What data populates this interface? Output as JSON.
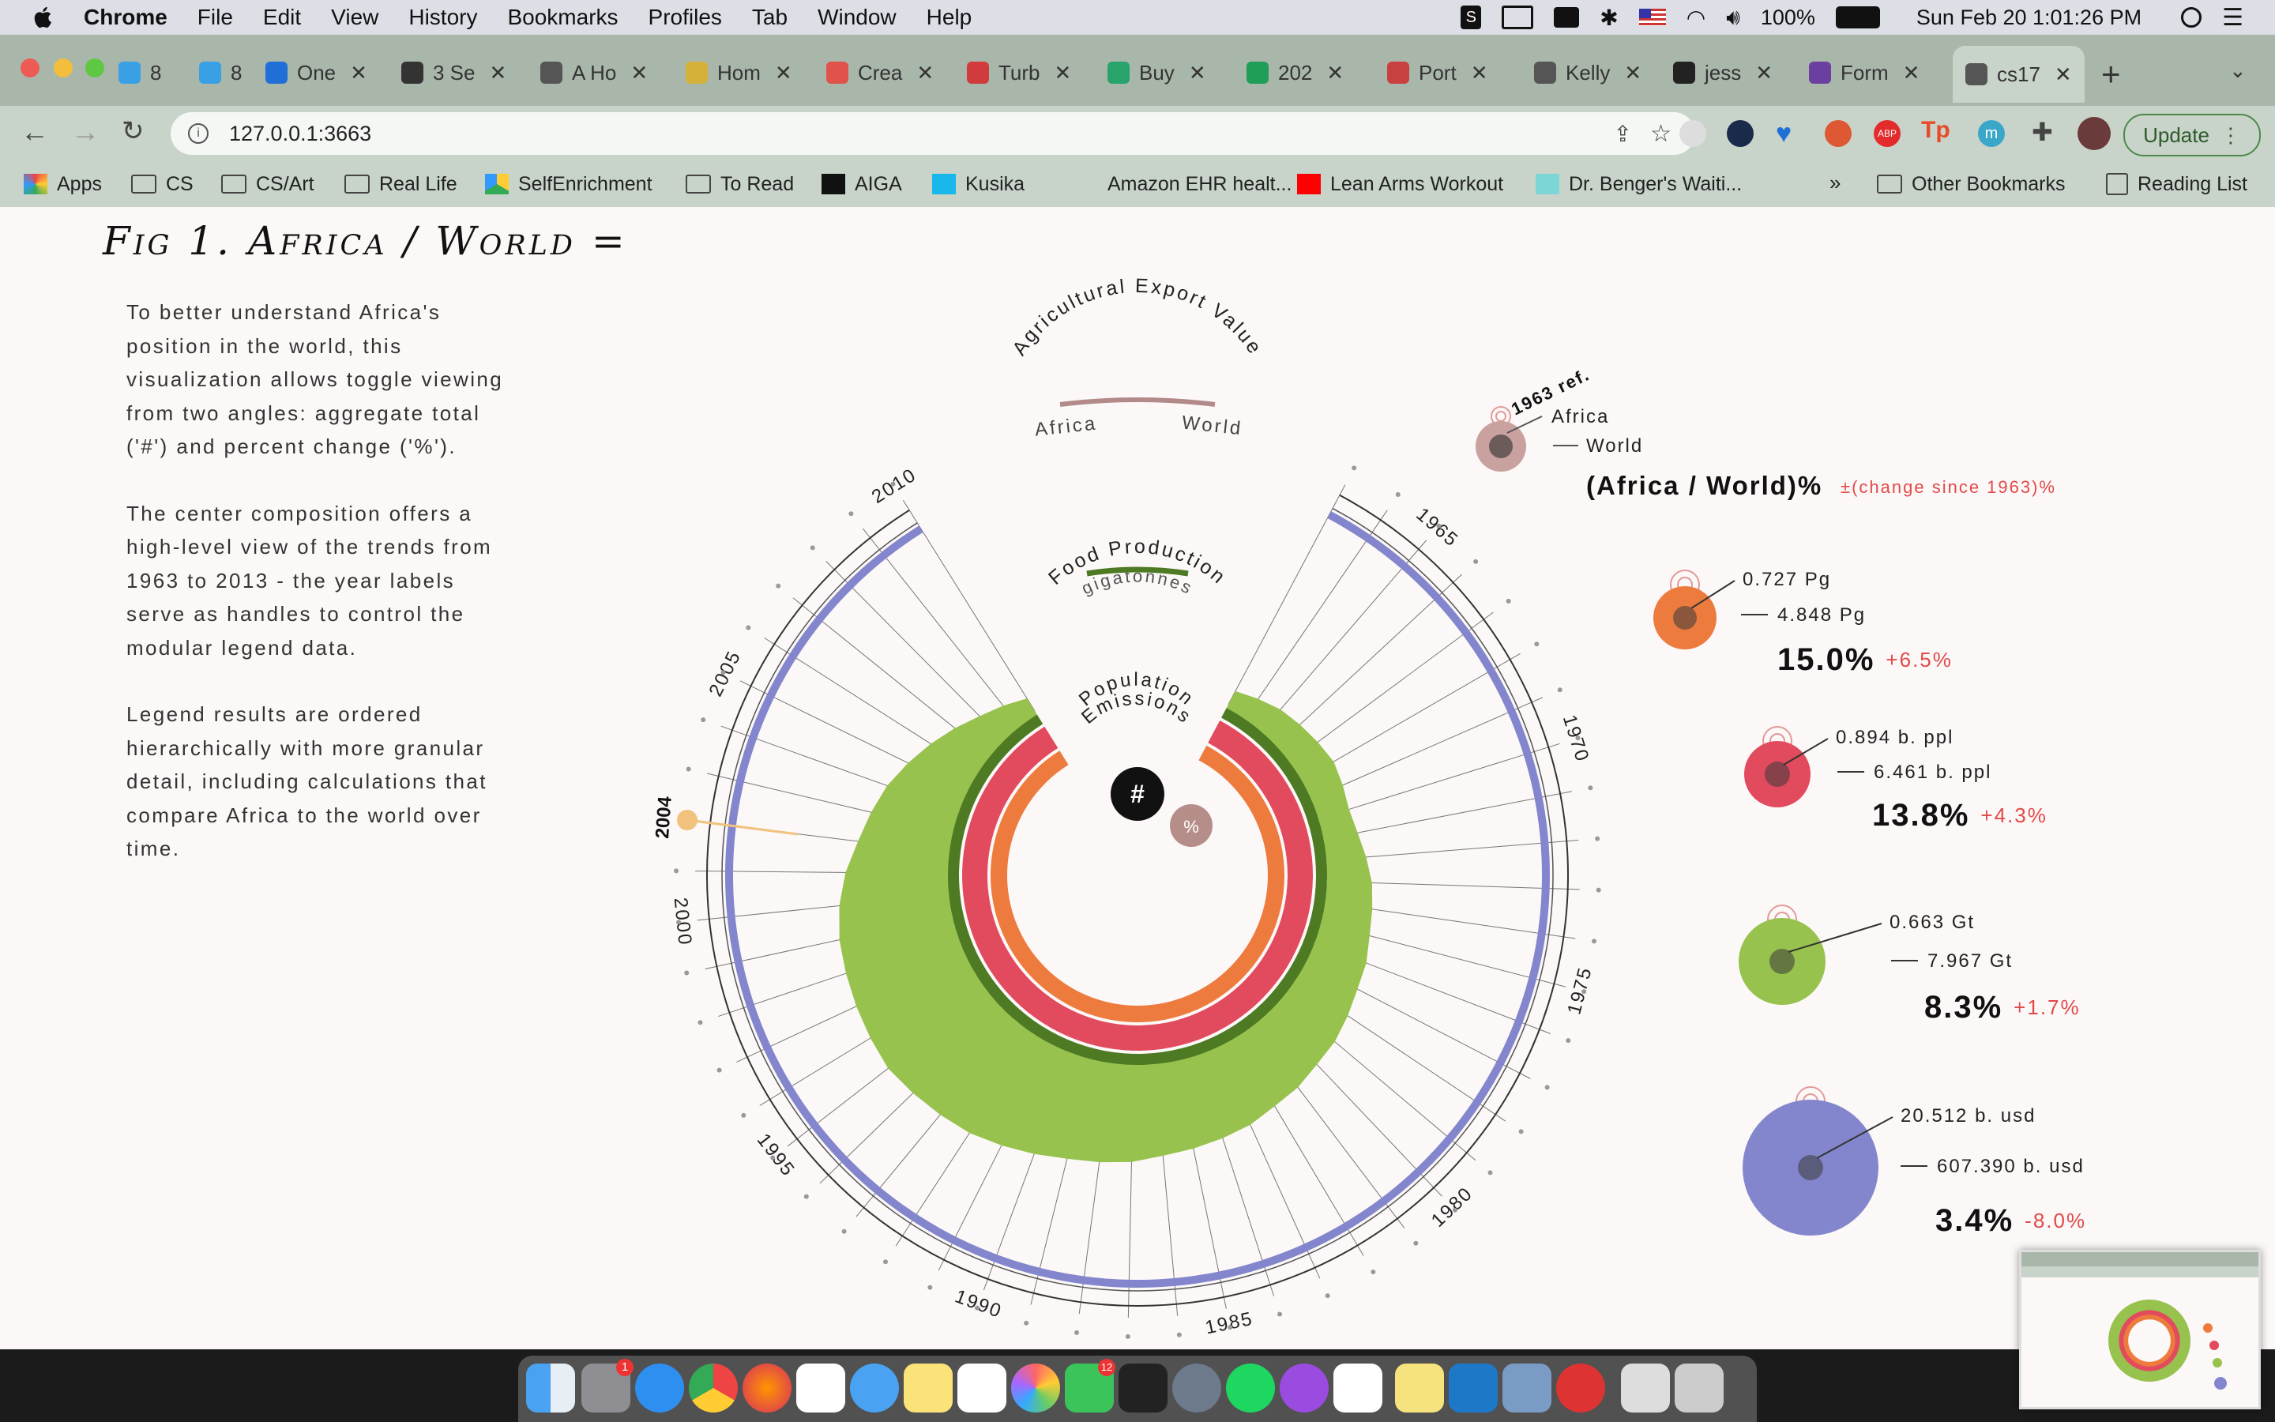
{
  "menubar": {
    "app": "Chrome",
    "items": [
      "File",
      "Edit",
      "View",
      "History",
      "Bookmarks",
      "Profiles",
      "Tab",
      "Window",
      "Help"
    ],
    "battery": "100%",
    "datetime": "Sun Feb 20  1:01:26 PM"
  },
  "tabs": [
    {
      "label": "8",
      "icon": "8-icon",
      "color": "#3aa0e6"
    },
    {
      "label": "8",
      "icon": "8-icon",
      "color": "#3aa0e6"
    },
    {
      "label": "One",
      "icon": "heart-icon",
      "color": "#1f6fd6"
    },
    {
      "label": "3 Se",
      "icon": "p-icon",
      "color": "#333333"
    },
    {
      "label": "A Ho",
      "icon": "globe-icon",
      "color": "#555555"
    },
    {
      "label": "Hom",
      "icon": "circle-icon",
      "color": "#d6b13a"
    },
    {
      "label": "Crea",
      "icon": "grid-icon",
      "color": "#e0524a"
    },
    {
      "label": "Turb",
      "icon": "check-icon",
      "color": "#d23b3b"
    },
    {
      "label": "Buy",
      "icon": "g-icon",
      "color": "#27a36b"
    },
    {
      "label": "202",
      "icon": "plus-icon",
      "color": "#1e9e57"
    },
    {
      "label": "Port",
      "icon": "trello-icon",
      "color": "#c84040"
    },
    {
      "label": "Kelly",
      "icon": "globe-icon",
      "color": "#555555"
    },
    {
      "label": "jess",
      "icon": "github-icon",
      "color": "#222222"
    },
    {
      "label": "Form",
      "icon": "b-icon",
      "color": "#6b3fa0"
    },
    {
      "label": "cs17",
      "icon": "globe-icon",
      "color": "#555555"
    }
  ],
  "omnibox": {
    "url": "127.0.0.1:3663",
    "update_label": "Update"
  },
  "bookmarks": [
    {
      "label": "Apps",
      "icon": "apps-icon"
    },
    {
      "label": "CS",
      "icon": "folder-icon"
    },
    {
      "label": "CS/Art",
      "icon": "folder-icon"
    },
    {
      "label": "Real Life",
      "icon": "folder-icon"
    },
    {
      "label": "SelfEnrichment",
      "icon": "drive-icon"
    },
    {
      "label": "To Read",
      "icon": "folder-icon"
    },
    {
      "label": "AIGA",
      "icon": "aiga-icon"
    },
    {
      "label": "Kusika",
      "icon": "v-icon"
    },
    {
      "label": "Amazon EHR healt...",
      "icon": "blank-icon"
    },
    {
      "label": "Lean Arms Workout",
      "icon": "youtube-icon"
    },
    {
      "label": "Dr. Benger's Waiti...",
      "icon": "puzzle-icon"
    }
  ],
  "bookmarks_right": {
    "other": "Other Bookmarks",
    "reading": "Reading List",
    "more": "»"
  },
  "page": {
    "title": "Fig 1. Africa / World =",
    "intro": [
      "To better understand Africa's position in the world, this visualization allows toggle viewing from two angles: aggregate total ('#') and percent change ('%').",
      "The center composition offers a high-level view of the trends from 1963 to 2013 - the year labels serve as handles to control the modular legend data.",
      "Legend results are ordered hierarchically with more granular detail, including calculations that compare Africa to the world over time."
    ]
  },
  "chart_data": {
    "type": "radial-area",
    "ring_labels": {
      "export": "Agricultural Export Value",
      "africa": "Africa",
      "world": "World",
      "food": "Food Production",
      "food_unit": "gigatonnes",
      "population": "Population",
      "emissions": "Emissions",
      "toggle_hash": "#",
      "toggle_pct": "%"
    },
    "year_ticks": [
      "1965",
      "1970",
      "1975",
      "1980",
      "1985",
      "1990",
      "1995",
      "2000",
      "2005",
      "2010"
    ],
    "selected_year": "2004",
    "food_production_relative": [
      0.8,
      0.82,
      0.84,
      0.85,
      0.86,
      0.87,
      0.86,
      0.85,
      0.86,
      0.88,
      0.9,
      0.91,
      0.92,
      0.94,
      0.95,
      0.97,
      0.99,
      1.0,
      1.02,
      1.03,
      1.05,
      1.06,
      1.07,
      1.08,
      1.1,
      1.11,
      1.12,
      1.14,
      1.16,
      1.18,
      1.19,
      1.2,
      1.21,
      1.2,
      1.19,
      1.18,
      1.17,
      1.15,
      1.12,
      1.08,
      1.05,
      1.02,
      0.98,
      0.94,
      0.9,
      0.86,
      0.83,
      0.8
    ],
    "colors": {
      "food": "#97c24e",
      "food_dark": "#4d7a22",
      "population": "#e24a5e",
      "emissions": "#ee7b3e",
      "export": "#8386cc",
      "handle": "#f1c27d"
    }
  },
  "legend": {
    "ref_label": "1963 ref.",
    "africa_label": "Africa",
    "world_label": "World",
    "heading": "(Africa / World)%",
    "heading_note": "±(change since 1963)%",
    "rows": [
      {
        "africa": "0.727 Pg",
        "world": "4.848 Pg",
        "pct": "15.0%",
        "change": "+6.5%",
        "color": "#ee7b3e"
      },
      {
        "africa": "0.894 b. ppl",
        "world": "6.461 b. ppl",
        "pct": "13.8%",
        "change": "+4.3%",
        "color": "#e24a5e"
      },
      {
        "africa": "0.663 Gt",
        "world": "7.967 Gt",
        "pct": "8.3%",
        "change": "+1.7%",
        "color": "#97c24e"
      },
      {
        "africa": "20.512 b. usd",
        "world": "607.390 b. usd",
        "pct": "3.4%",
        "change": "-8.0%",
        "color": "#8386cc"
      }
    ]
  },
  "dock_badges": {
    "settings": "1",
    "facetime": "12"
  }
}
